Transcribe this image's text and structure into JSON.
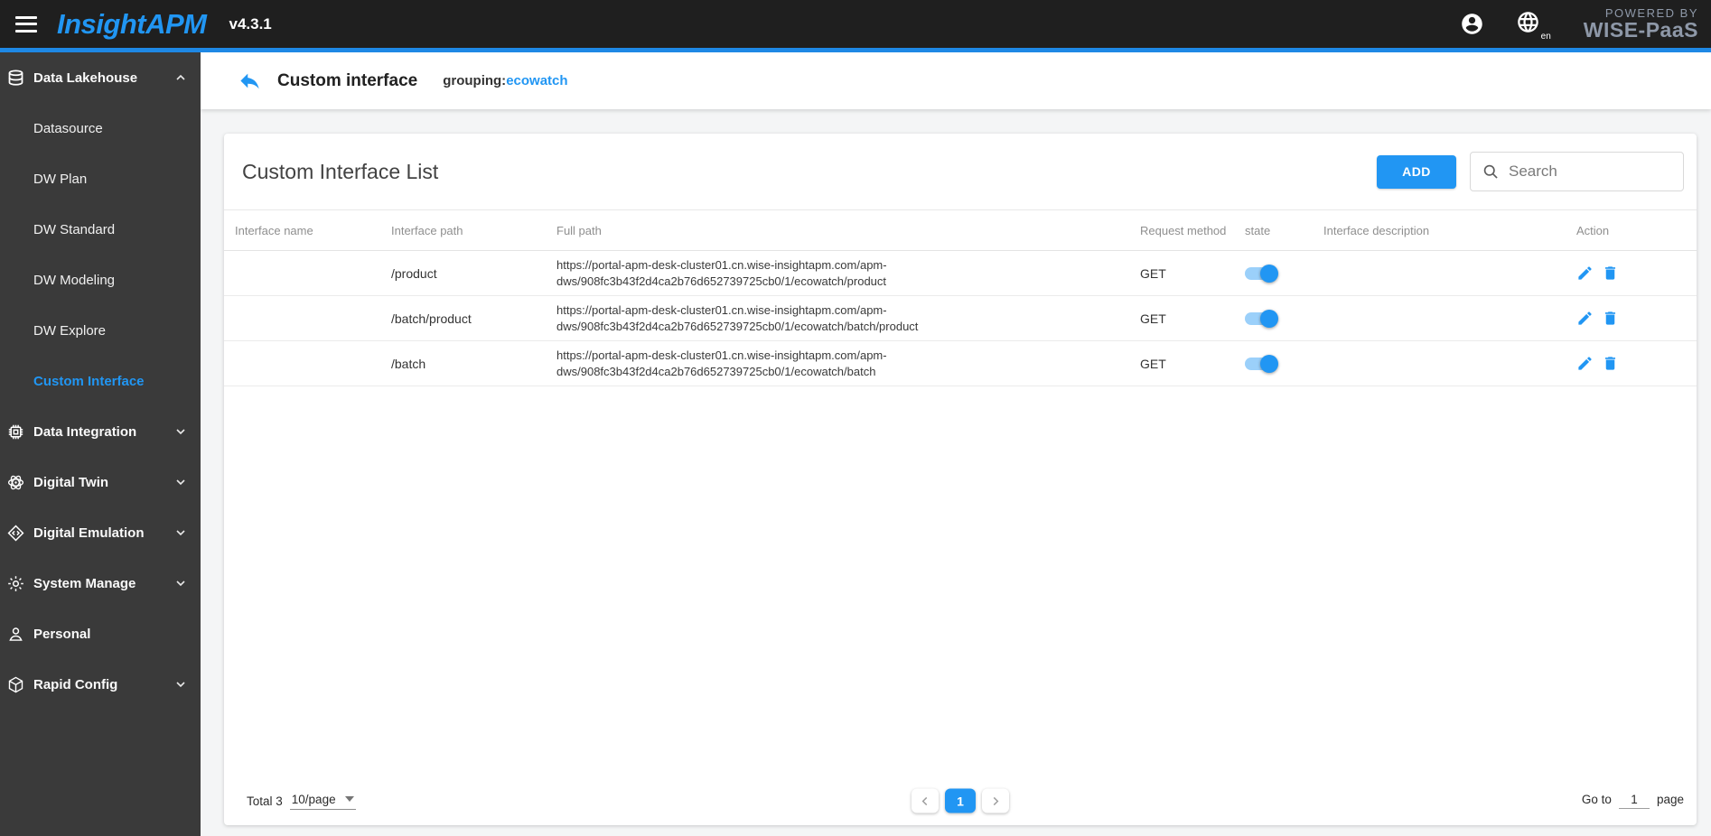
{
  "colors": {
    "accent": "#2196f3",
    "topbar_bg": "#1f1f1f",
    "sidebar_bg": "#3a3a3a",
    "accent_line": "#1e88e5",
    "powered_gray": "#8e98a8"
  },
  "topbar": {
    "logo": "InsightAPM",
    "version": "v4.3.1",
    "language": "en",
    "powered_by_line1": "POWERED BY",
    "powered_by_line2": "WISE-PaaS"
  },
  "sidebar": {
    "items": [
      {
        "label": "Data Lakehouse",
        "icon": "database-icon",
        "expanded": true,
        "children": [
          {
            "label": "Datasource"
          },
          {
            "label": "DW Plan"
          },
          {
            "label": "DW Standard"
          },
          {
            "label": "DW Modeling"
          },
          {
            "label": "DW Explore"
          },
          {
            "label": "Custom Interface",
            "active": true
          }
        ]
      },
      {
        "label": "Data Integration",
        "icon": "chip-icon",
        "expanded": false
      },
      {
        "label": "Digital Twin",
        "icon": "atom-icon",
        "expanded": false
      },
      {
        "label": "Digital Emulation",
        "icon": "emulation-icon",
        "expanded": false
      },
      {
        "label": "System Manage",
        "icon": "gear-icon",
        "expanded": false
      },
      {
        "label": "Personal",
        "icon": "person-icon"
      },
      {
        "label": "Rapid Config",
        "icon": "cube-icon",
        "expanded": false
      }
    ]
  },
  "subheader": {
    "title": "Custom interface",
    "grouping_label": "grouping:",
    "grouping_value": "ecowatch"
  },
  "main": {
    "card_title": "Custom Interface List",
    "add_button": "ADD",
    "search_placeholder": "Search",
    "table": {
      "columns": {
        "name": "Interface name",
        "path": "Interface path",
        "full": "Full path",
        "method": "Request method",
        "state": "state",
        "desc": "Interface description",
        "action": "Action"
      },
      "rows": [
        {
          "interface_name_redacted": true,
          "interface_path": "/product",
          "full_path": "https://portal-apm-desk-cluster01.cn.wise-insightapm.com/apm-dws/908fc3b43f2d4ca2b76d652739725cb0/1/ecowatch/product",
          "request_method": "GET",
          "state_on": true,
          "description": ""
        },
        {
          "interface_name_redacted": true,
          "interface_path": "/batch/product",
          "full_path": "https://portal-apm-desk-cluster01.cn.wise-insightapm.com/apm-dws/908fc3b43f2d4ca2b76d652739725cb0/1/ecowatch/batch/product",
          "request_method": "GET",
          "state_on": true,
          "description": ""
        },
        {
          "interface_name_redacted": true,
          "interface_path": "/batch",
          "full_path": "https://portal-apm-desk-cluster01.cn.wise-insightapm.com/apm-dws/908fc3b43f2d4ca2b76d652739725cb0/1/ecowatch/batch",
          "request_method": "GET",
          "state_on": true,
          "description": ""
        }
      ]
    },
    "footer": {
      "total": "Total 3",
      "page_size": "10/page",
      "current_page": "1",
      "goto_label": "Go to",
      "goto_value": "1",
      "page_label": "page"
    }
  }
}
